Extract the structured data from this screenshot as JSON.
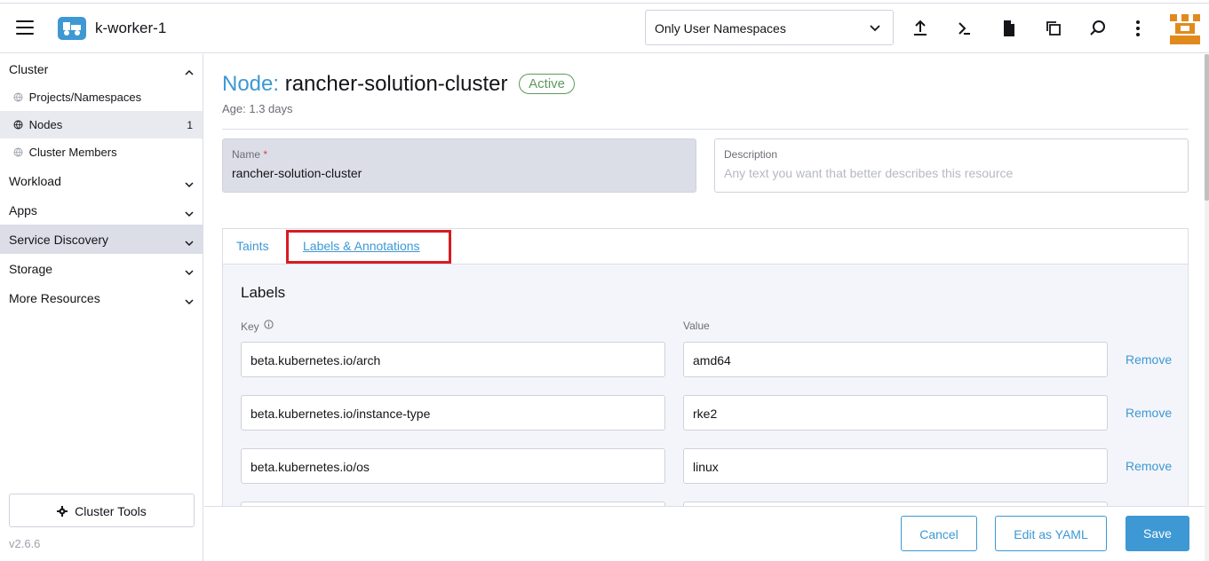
{
  "header": {
    "cluster_name": "k-worker-1",
    "namespace_filter": "Only User Namespaces",
    "icons": [
      "hamburger-icon",
      "cluster-badge-icon",
      "upload-icon",
      "kubectl-shell-icon",
      "kubeconfig-file-icon",
      "copy-kubeconfig-icon",
      "search-icon",
      "more-vertical-icon",
      "rancher-logo"
    ]
  },
  "sidebar": {
    "groups": [
      {
        "label": "Cluster",
        "expanded": true
      },
      {
        "label": "Workload"
      },
      {
        "label": "Apps"
      },
      {
        "label": "Service Discovery"
      },
      {
        "label": "Storage"
      },
      {
        "label": "More Resources"
      }
    ],
    "cluster_items": [
      {
        "label": "Projects/Namespaces"
      },
      {
        "label": "Nodes",
        "count": "1"
      },
      {
        "label": "Cluster Members"
      }
    ],
    "cluster_tools": "Cluster Tools",
    "version": "v2.6.6"
  },
  "page": {
    "kind": "Node:",
    "name": "rancher-solution-cluster",
    "status": "Active",
    "age": "Age: 1.3 days",
    "name_field": {
      "label": "Name",
      "required_mark": "*",
      "value": "rancher-solution-cluster"
    },
    "description_field": {
      "label": "Description",
      "placeholder": "Any text you want that better describes this resource"
    },
    "tabs": [
      "Taints",
      "Labels & Annotations"
    ],
    "active_tab": "Labels & Annotations",
    "labels": {
      "title": "Labels",
      "key_header": "Key",
      "value_header": "Value",
      "remove_label": "Remove",
      "rows": [
        {
          "key": "beta.kubernetes.io/arch",
          "value": "amd64"
        },
        {
          "key": "beta.kubernetes.io/instance-type",
          "value": "rke2"
        },
        {
          "key": "beta.kubernetes.io/os",
          "value": "linux"
        }
      ]
    }
  },
  "footer": {
    "cancel": "Cancel",
    "edit_yaml": "Edit as YAML",
    "save": "Save"
  },
  "colors": {
    "accent": "#3d98d3",
    "active_status": "#5d995d",
    "highlight_box": "#d71b22",
    "logo": "#e08a1e"
  }
}
